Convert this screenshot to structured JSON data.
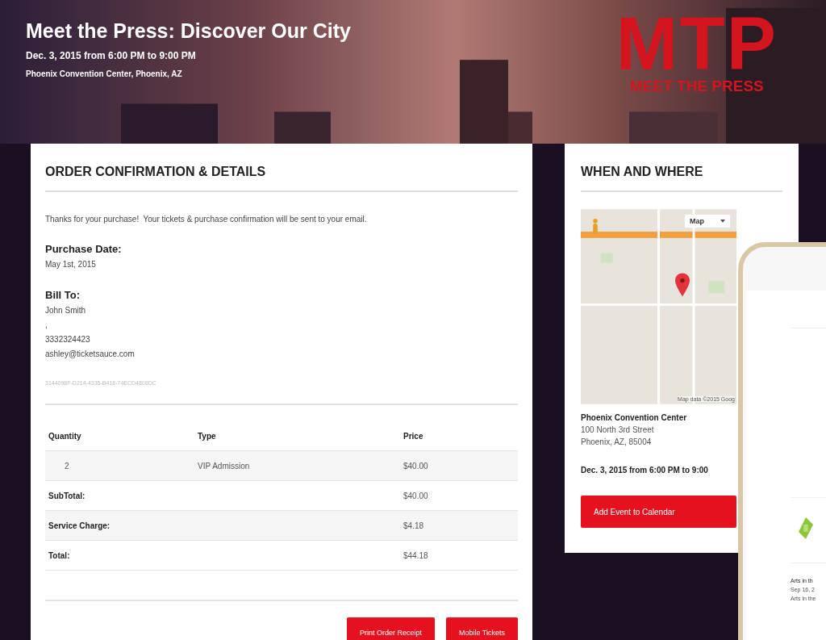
{
  "hero": {
    "title": "Meet the Press: Discover Our City",
    "date": "Dec. 3, 2015 from 6:00 PM to 9:00 PM",
    "venue": "Phoenix Convention Center, Phoenix, AZ",
    "logo_mark": "MTP",
    "logo_text": "MEET THE PRESS"
  },
  "order": {
    "heading": "ORDER CONFIRMATION & DETAILS",
    "thanks": "Thanks for your purchase!  Your tickets & purchase confirmation will be sent to your email.",
    "purchase_date_label": "Purchase Date:",
    "purchase_date": "May 1st, 2015",
    "bill_to_label": "Bill To:",
    "bill_to": [
      "John Smith",
      ",",
      "3332324423",
      "ashley@ticketsauce.com"
    ],
    "order_id": "3144098F-D214-4335-B418-74ECD4808DC",
    "columns": [
      "Quantity",
      "Type",
      "Price"
    ],
    "rows": [
      {
        "cells": [
          "2",
          "VIP Admission",
          "$40.00"
        ]
      }
    ],
    "totals": [
      {
        "label": "SubTotal:",
        "value": "$40.00"
      },
      {
        "label": "Service Charge:",
        "value": "$4.18"
      },
      {
        "label": "Total:",
        "value": "$44.18"
      }
    ],
    "buttons": [
      "Print Order Receipt",
      "Mobile Tickets"
    ]
  },
  "where": {
    "heading": "WHEN AND WHERE",
    "map_type": "Map",
    "map_credit": "Map data ©2015 Goog",
    "venue": "Phoenix Convention Center",
    "address": [
      "100 North 3rd Street",
      "Phoenix, AZ, 85004"
    ],
    "date": "Dec. 3, 2015 from 6:00 PM to 9:00",
    "button": "Add Event to Calendar"
  },
  "phone": {
    "event_lines": [
      "Arts in th",
      "Sep 16, 2",
      "Arts in the"
    ]
  }
}
